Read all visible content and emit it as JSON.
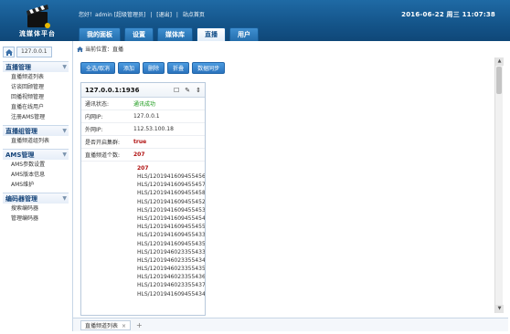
{
  "header": {
    "app_name": "流媒体平台",
    "greeting": "您好！admin [超级管理员]",
    "logout": "[退出]",
    "home": "站点首页",
    "datetime": "2016-06-22 周三 11:07:38"
  },
  "nav": {
    "tabs": [
      "我的面板",
      "设置",
      "媒体库",
      "直播",
      "用户"
    ],
    "active": "直播"
  },
  "sidebar": {
    "home_icon": "home-icon",
    "ip_label": "127.0.0.1",
    "groups": [
      {
        "title": "直播管理",
        "items": [
          "直播频道列表",
          "访谈回顾管理",
          "回播视频管理",
          "直播在线用户",
          "注册AMS管理"
        ]
      },
      {
        "title": "直播组管理",
        "items": [
          "直播频道组列表"
        ]
      },
      {
        "title": "AMS管理",
        "items": [
          "AMS参数设置",
          "AMS版本信息",
          "AMS维护"
        ]
      },
      {
        "title": "编码器管理",
        "items": [
          "搜索编码器",
          "管理编码器"
        ]
      }
    ]
  },
  "main": {
    "breadcrumb": "当前位置：直播",
    "toolbar": [
      "全选/取消",
      "添加",
      "删除",
      "折叠",
      "数据同步"
    ],
    "card": {
      "title": "127.0.0.1:1936",
      "rows": [
        {
          "label": "通讯状态:",
          "value": "通讯成功",
          "style": "green"
        },
        {
          "label": "内网IP:",
          "value": "127.0.0.1",
          "style": ""
        },
        {
          "label": "外网IP:",
          "value": "112.53.100.18",
          "style": ""
        },
        {
          "label": "是否开启集群:",
          "value": "true",
          "style": "red"
        },
        {
          "label": "直播频道个数:",
          "value": "207",
          "style": "red"
        }
      ],
      "channel_count": "207",
      "channels": [
        "HLS/1201941609455456",
        "HLS/1201941609455457",
        "HLS/1201941609455458",
        "HLS/1201941609455452",
        "HLS/1201941609455453",
        "HLS/1201941609455454",
        "HLS/1201941609455455",
        "HLS/1201941609455433",
        "HLS/1201941609455435",
        "HLS/1201946023355433",
        "HLS/1201946023355434",
        "HLS/1201946023355435",
        "HLS/1201946023355436",
        "HLS/1201946023355437",
        "HLS/1201941609455434"
      ]
    },
    "bottom_tab": "直播频道列表"
  }
}
